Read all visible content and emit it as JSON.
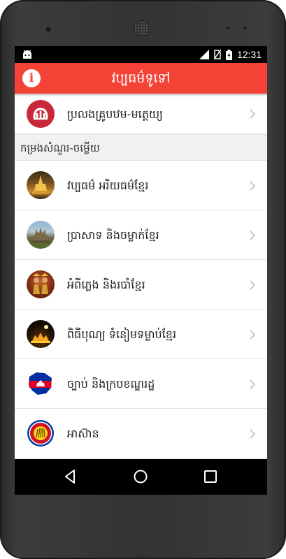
{
  "status_bar": {
    "time": "12:31",
    "icons": [
      "android-icon",
      "signal-icon",
      "no-sim-icon",
      "battery-icon"
    ]
  },
  "app_bar": {
    "info_icon": "i",
    "title": "វប្បធម៌ទូទៅ"
  },
  "list": {
    "top_item": {
      "label": "ប្រលងគ្រូបឋម-មត្តេយ្យ",
      "icon": "khmer-letter-logo-icon"
    },
    "section_header": "កម្រងសំណួរ-ចម្លើយ",
    "items": [
      {
        "label": "វប្បធម៌ អរិយធម៌ខ្មែរ",
        "icon": "golden-temple-icon"
      },
      {
        "label": "ប្រាសាទ និងចម្លាក់ខ្មែរ",
        "icon": "angkor-temple-icon"
      },
      {
        "label": "អំពីភ្លេង និងរបាំខ្មែរ",
        "icon": "apsara-dancers-icon"
      },
      {
        "label": "ពិធីបុណ្យ ទំនៀមទម្លាប់ខ្មែរ",
        "icon": "festival-night-icon"
      },
      {
        "label": "ច្បាប់ និងក្របខណ្ឌរដ្ឋ",
        "icon": "cambodia-flag-map-icon"
      },
      {
        "label": "អាស៊ាន",
        "icon": "asean-emblem-icon"
      }
    ]
  },
  "nav_bar": {
    "icons": [
      "back-icon",
      "home-icon",
      "recents-icon"
    ]
  },
  "colors": {
    "app_bar": "#f44336",
    "status_bar": "#000000",
    "nav_bar": "#000000",
    "section_bg": "#f1f1f1"
  }
}
